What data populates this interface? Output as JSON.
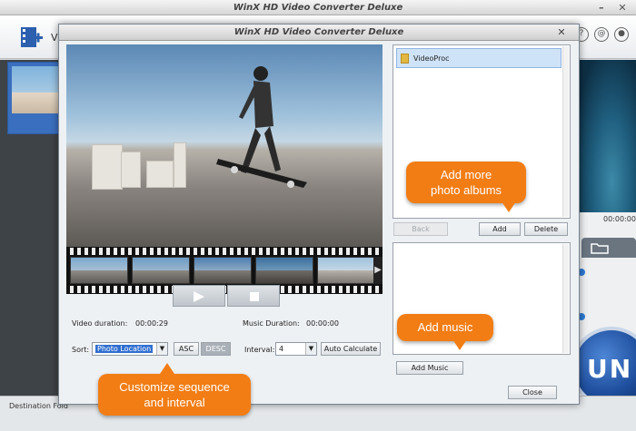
{
  "app": {
    "title": "WinX HD Video Converter Deluxe",
    "toolbar_label_partial": "V",
    "time_display": "00:00:00",
    "destination_label": "Destination Fold",
    "run_label": "UN"
  },
  "dialog": {
    "title": "WinX HD Video Converter Deluxe",
    "video_duration_label": "Video duration:",
    "video_duration_value": "00:00:29",
    "music_duration_label": "Music Duration:",
    "music_duration_value": "00:00:00",
    "sort_label": "Sort:",
    "sort_value": "Photo Location",
    "asc_label": "ASC",
    "desc_label": "DESC",
    "interval_label": "Interval:",
    "interval_value": "4",
    "auto_calc_label": "Auto Calculate",
    "album_item": "VideoProc",
    "back_label": "Back",
    "add_label": "Add",
    "delete_label": "Delete",
    "add_music_label": "Add Music",
    "close_label": "Close"
  },
  "callouts": {
    "albums": "Add more\nphoto albums",
    "music": "Add music",
    "sequence": "Customize sequence\nand interval"
  },
  "colors": {
    "accent_orange": "#f27d14",
    "selection_blue": "#2f6fd0",
    "run_blue": "#1f4f9e"
  },
  "icons": [
    "add-video-icon",
    "help-icon",
    "mail-icon",
    "user-icon",
    "folder-icon",
    "play-icon",
    "stop-icon",
    "close-icon",
    "minimize-icon",
    "info-icon"
  ]
}
